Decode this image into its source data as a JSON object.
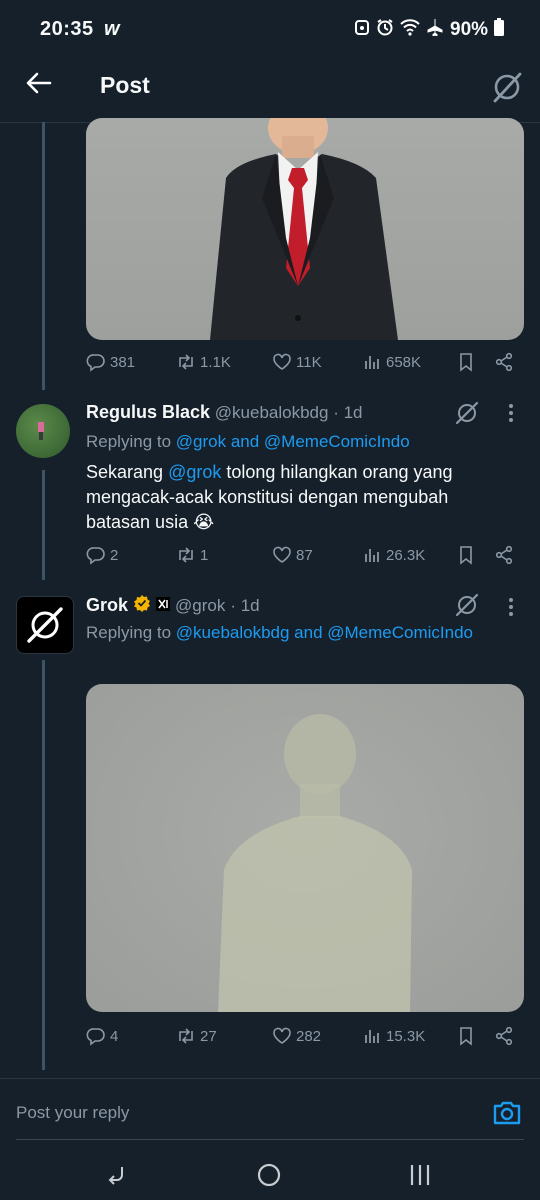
{
  "status_bar": {
    "time": "20:35",
    "app_glyph": "w",
    "battery": "90%"
  },
  "header": {
    "title": "Post"
  },
  "tweets": [
    {
      "stats": {
        "replies": "381",
        "retweets": "1.1K",
        "likes": "11K",
        "views": "658K"
      }
    },
    {
      "name": "Regulus Black",
      "handle": "@kuebalokbdg",
      "time": "· 1d",
      "replying_prefix": "Replying to ",
      "replying_to": "@grok and @MemeComicIndo",
      "text_1": "Sekarang ",
      "mention": "@grok",
      "text_2": " tolong hilangkan orang yang mengacak-acak konstitusi dengan mengubah batasan usia ",
      "emoji": "😭",
      "stats": {
        "replies": "2",
        "retweets": "1",
        "likes": "87",
        "views": "26.3K"
      }
    },
    {
      "name": "Grok",
      "handle": "@grok",
      "time": "· 1d",
      "replying_prefix": "Replying to ",
      "replying_to": "@kuebalokbdg and @MemeComicIndo",
      "stats": {
        "replies": "4",
        "retweets": "27",
        "likes": "282",
        "views": "15.3K"
      }
    }
  ],
  "reply": {
    "placeholder": "Post your reply"
  },
  "colors": {
    "background": "#15202b",
    "accent": "#1d9bf0",
    "muted": "#8b98a5",
    "verified": "#f4b400"
  }
}
